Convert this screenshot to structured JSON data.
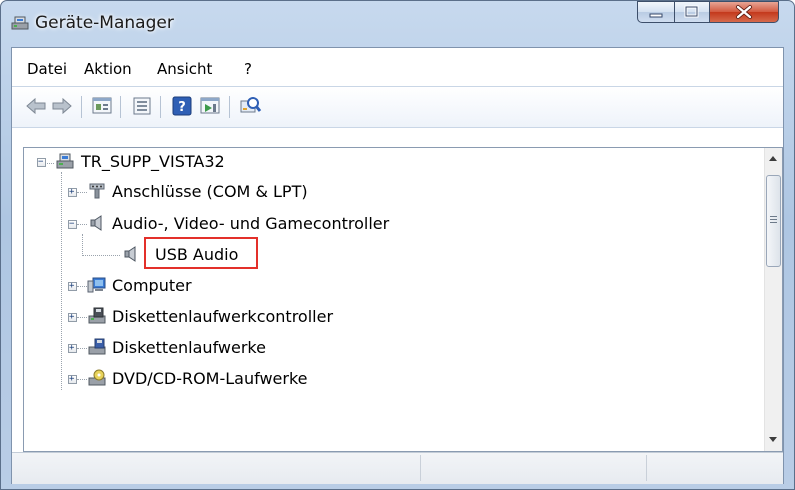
{
  "window": {
    "title": "Geräte-Manager",
    "accent": "#c3381c"
  },
  "menu": [
    "Datei",
    "Aktion",
    "Ansicht",
    "?"
  ],
  "toolbar": {
    "buttons": [
      "back-icon",
      "forward-icon",
      "properties-icon",
      "show-hide-icon",
      "help-icon",
      "update-driver-icon",
      "scan-hardware-icon"
    ]
  },
  "tree": {
    "root": "TR_SUPP_VISTA32",
    "nodes": [
      {
        "label": "Anschlüsse (COM & LPT)",
        "icon": "port-icon",
        "expanded": false
      },
      {
        "label": "Audio-, Video- und Gamecontroller",
        "icon": "speaker-icon",
        "expanded": true,
        "children": [
          {
            "label": "USB Audio",
            "icon": "speaker-icon",
            "highlighted": true
          }
        ]
      },
      {
        "label": "Computer",
        "icon": "computer-icon",
        "expanded": false
      },
      {
        "label": "Diskettenlaufwerkcontroller",
        "icon": "disk-controller-icon",
        "expanded": false
      },
      {
        "label": "Diskettenlaufwerke",
        "icon": "floppy-drive-icon",
        "expanded": false
      },
      {
        "label": "DVD/CD-ROM-Laufwerke",
        "icon": "dvd-drive-icon",
        "expanded": false
      }
    ]
  },
  "status": [
    "",
    "",
    ""
  ]
}
